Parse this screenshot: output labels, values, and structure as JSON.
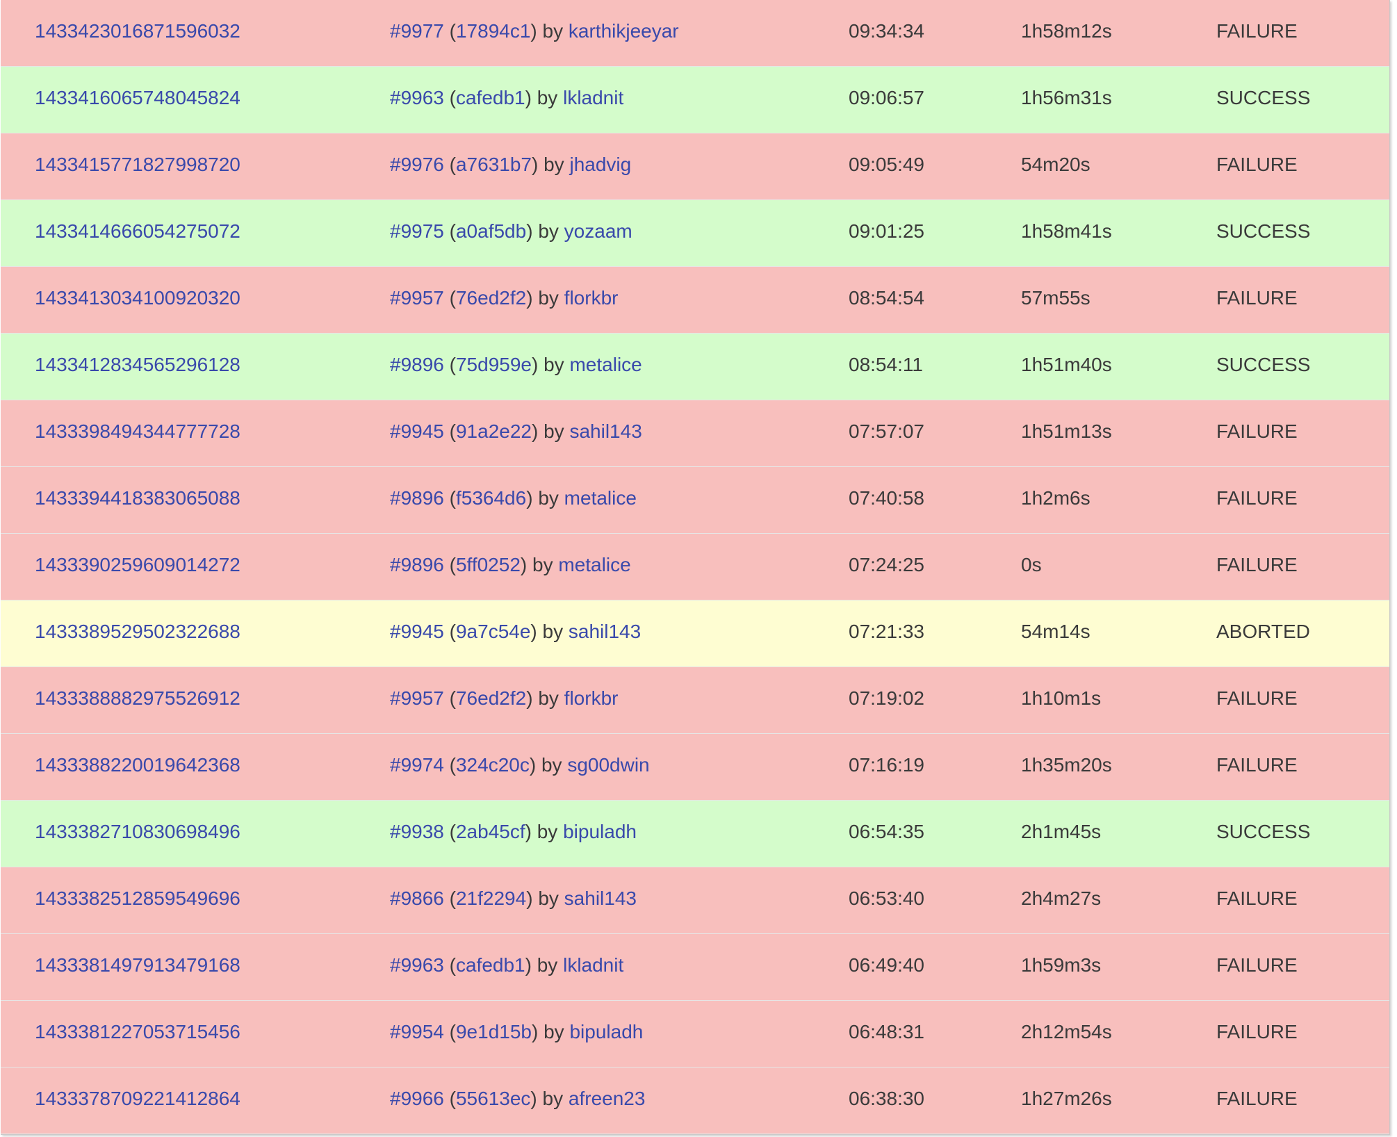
{
  "colors": {
    "failure": "#f8bfbd",
    "success": "#d4fccb",
    "aborted": "#fefdd2",
    "link": "#3949ab",
    "text": "#3a3a3a"
  },
  "rows": [
    {
      "id": "1433423016871596032",
      "pr": "#9977",
      "commit": "17894c1",
      "author": "karthikjeeyar",
      "time": "09:34:34",
      "duration": "1h58m12s",
      "status": "FAILURE"
    },
    {
      "id": "1433416065748045824",
      "pr": "#9963",
      "commit": "cafedb1",
      "author": "lkladnit",
      "time": "09:06:57",
      "duration": "1h56m31s",
      "status": "SUCCESS"
    },
    {
      "id": "1433415771827998720",
      "pr": "#9976",
      "commit": "a7631b7",
      "author": "jhadvig",
      "time": "09:05:49",
      "duration": "54m20s",
      "status": "FAILURE"
    },
    {
      "id": "1433414666054275072",
      "pr": "#9975",
      "commit": "a0af5db",
      "author": "yozaam",
      "time": "09:01:25",
      "duration": "1h58m41s",
      "status": "SUCCESS"
    },
    {
      "id": "1433413034100920320",
      "pr": "#9957",
      "commit": "76ed2f2",
      "author": "florkbr",
      "time": "08:54:54",
      "duration": "57m55s",
      "status": "FAILURE"
    },
    {
      "id": "1433412834565296128",
      "pr": "#9896",
      "commit": "75d959e",
      "author": "metalice",
      "time": "08:54:11",
      "duration": "1h51m40s",
      "status": "SUCCESS"
    },
    {
      "id": "1433398494344777728",
      "pr": "#9945",
      "commit": "91a2e22",
      "author": "sahil143",
      "time": "07:57:07",
      "duration": "1h51m13s",
      "status": "FAILURE"
    },
    {
      "id": "1433394418383065088",
      "pr": "#9896",
      "commit": "f5364d6",
      "author": "metalice",
      "time": "07:40:58",
      "duration": "1h2m6s",
      "status": "FAILURE"
    },
    {
      "id": "1433390259609014272",
      "pr": "#9896",
      "commit": "5ff0252",
      "author": "metalice",
      "time": "07:24:25",
      "duration": "0s",
      "status": "FAILURE"
    },
    {
      "id": "1433389529502322688",
      "pr": "#9945",
      "commit": "9a7c54e",
      "author": "sahil143",
      "time": "07:21:33",
      "duration": "54m14s",
      "status": "ABORTED"
    },
    {
      "id": "1433388882975526912",
      "pr": "#9957",
      "commit": "76ed2f2",
      "author": "florkbr",
      "time": "07:19:02",
      "duration": "1h10m1s",
      "status": "FAILURE"
    },
    {
      "id": "1433388220019642368",
      "pr": "#9974",
      "commit": "324c20c",
      "author": "sg00dwin",
      "time": "07:16:19",
      "duration": "1h35m20s",
      "status": "FAILURE"
    },
    {
      "id": "1433382710830698496",
      "pr": "#9938",
      "commit": "2ab45cf",
      "author": "bipuladh",
      "time": "06:54:35",
      "duration": "2h1m45s",
      "status": "SUCCESS"
    },
    {
      "id": "1433382512859549696",
      "pr": "#9866",
      "commit": "21f2294",
      "author": "sahil143",
      "time": "06:53:40",
      "duration": "2h4m27s",
      "status": "FAILURE"
    },
    {
      "id": "1433381497913479168",
      "pr": "#9963",
      "commit": "cafedb1",
      "author": "lkladnit",
      "time": "06:49:40",
      "duration": "1h59m3s",
      "status": "FAILURE"
    },
    {
      "id": "1433381227053715456",
      "pr": "#9954",
      "commit": "9e1d15b",
      "author": "bipuladh",
      "time": "06:48:31",
      "duration": "2h12m54s",
      "status": "FAILURE"
    },
    {
      "id": "1433378709221412864",
      "pr": "#9966",
      "commit": "55613ec",
      "author": "afreen23",
      "time": "06:38:30",
      "duration": "1h27m26s",
      "status": "FAILURE"
    }
  ],
  "labels": {
    "open_paren": "(",
    "close_paren": ")",
    "by": "by"
  }
}
